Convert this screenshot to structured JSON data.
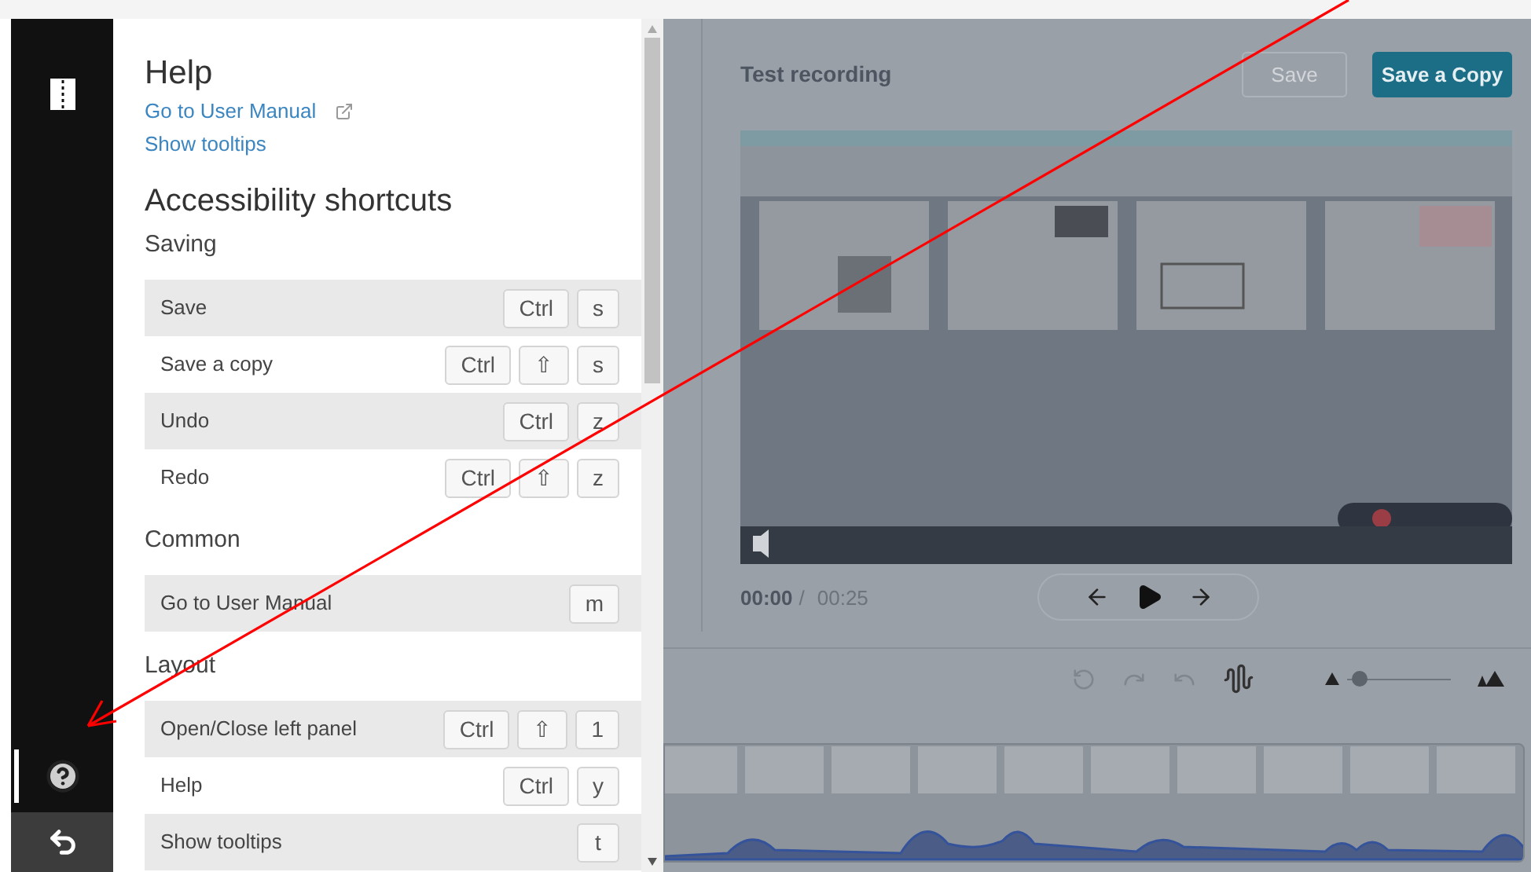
{
  "sidebar": {
    "items": [
      {
        "kind": "panels",
        "selected": false
      },
      {
        "kind": "help",
        "selected": true
      },
      {
        "kind": "back",
        "selected": false
      }
    ]
  },
  "help": {
    "title": "Help",
    "links": [
      {
        "label": "Go to User Manual",
        "external": true
      },
      {
        "label": "Show tooltips",
        "external": false
      }
    ],
    "shortcuts_title": "Accessibility shortcuts",
    "sections": [
      {
        "title": "Saving",
        "shortcuts": [
          {
            "label": "Save",
            "keys": [
              "Ctrl",
              "s"
            ]
          },
          {
            "label": "Save a copy",
            "keys": [
              "Ctrl",
              "⇧",
              "s"
            ]
          },
          {
            "label": "Undo",
            "keys": [
              "Ctrl",
              "z"
            ]
          },
          {
            "label": "Redo",
            "keys": [
              "Ctrl",
              "⇧",
              "z"
            ]
          }
        ]
      },
      {
        "title": "Common",
        "shortcuts": [
          {
            "label": "Go to User Manual",
            "keys": [
              "m"
            ]
          }
        ]
      },
      {
        "title": "Layout",
        "shortcuts": [
          {
            "label": "Open/Close left panel",
            "keys": [
              "Ctrl",
              "⇧",
              "1"
            ]
          },
          {
            "label": "Help",
            "keys": [
              "Ctrl",
              "y"
            ]
          },
          {
            "label": "Show tooltips",
            "keys": [
              "t"
            ]
          }
        ]
      }
    ]
  },
  "editor": {
    "title": "Test recording",
    "save_button": {
      "label": "Save",
      "disabled": true
    },
    "save_copy_button": {
      "label": "Save a Copy",
      "disabled": false
    },
    "current_time": "00:00",
    "separator": "/",
    "duration": "00:25",
    "zoom": {
      "level": 0.05
    }
  }
}
